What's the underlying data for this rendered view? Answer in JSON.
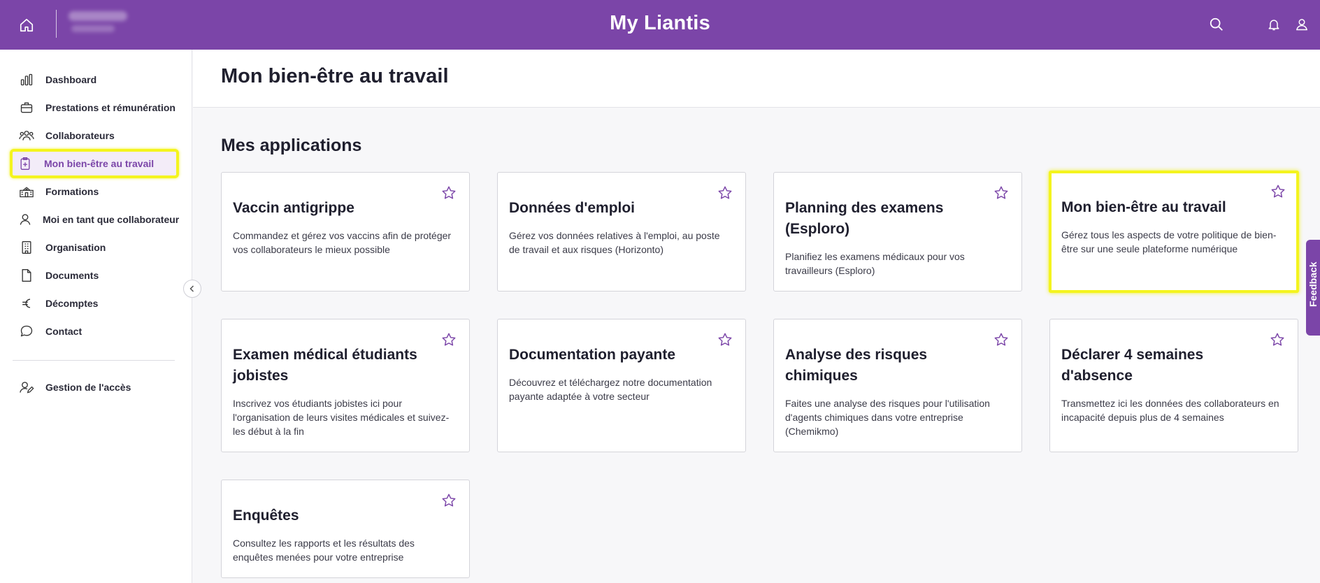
{
  "app": {
    "title": "My Liantis"
  },
  "topbar": {
    "home_icon": "home-icon",
    "search_icon": "search-icon",
    "bell_icon": "bell-icon",
    "user_icon": "user-icon"
  },
  "sidebar": {
    "items": [
      {
        "label": "Dashboard",
        "icon": "chart-icon"
      },
      {
        "label": "Prestations et rémunération",
        "icon": "briefcase-icon"
      },
      {
        "label": "Collaborateurs",
        "icon": "users-icon"
      },
      {
        "label": "Mon bien-être au travail",
        "icon": "health-icon",
        "active": true
      },
      {
        "label": "Formations",
        "icon": "school-icon"
      },
      {
        "label": "Moi en tant que collaborateur",
        "icon": "person-icon"
      },
      {
        "label": "Organisation",
        "icon": "building-icon"
      },
      {
        "label": "Documents",
        "icon": "document-icon"
      },
      {
        "label": "Décomptes",
        "icon": "euro-icon"
      },
      {
        "label": "Contact",
        "icon": "chat-icon"
      }
    ],
    "bottom_items": [
      {
        "label": "Gestion de l'accès",
        "icon": "user-edit-icon"
      }
    ]
  },
  "page": {
    "title": "Mon bien-être au travail",
    "section_title": "Mes applications"
  },
  "cards": [
    {
      "title": "Vaccin antigrippe",
      "desc": "Commandez et gérez vos vaccins afin de protéger vos collaborateurs le mieux possible"
    },
    {
      "title": "Données d'emploi",
      "desc": "Gérez vos données relatives à l'emploi, au poste de travail et aux risques (Horizonto)"
    },
    {
      "title": "Planning des examens (Esploro)",
      "desc": "Planifiez les examens médicaux pour vos travailleurs (Esploro)"
    },
    {
      "title": "Mon bien-être au travail",
      "desc": "Gérez tous les aspects de votre politique de bien-être sur une seule plateforme numérique",
      "highlighted": true
    },
    {
      "title": "Examen médical étudiants jobistes",
      "desc": "Inscrivez vos étudiants jobistes ici pour l'organisation de leurs visites médicales et suivez-les début à la fin"
    },
    {
      "title": "Documentation payante",
      "desc": "Découvrez et téléchargez notre documentation payante adaptée à votre secteur"
    },
    {
      "title": "Analyse des risques chimiques",
      "desc": "Faites une analyse des risques pour l'utilisation d'agents chimiques dans votre entreprise (Chemikmo)"
    },
    {
      "title": "Déclarer 4 semaines d'absence",
      "desc": "Transmettez ici les données des collaborateurs en incapacité depuis plus de 4 semaines"
    },
    {
      "title": "Enquêtes",
      "desc": "Consultez les rapports et les résultats des enquêtes menées pour votre entreprise"
    }
  ],
  "feedback": {
    "label": "Feedback"
  },
  "colors": {
    "brand": "#7b45a8",
    "highlight": "#f4f41e"
  }
}
